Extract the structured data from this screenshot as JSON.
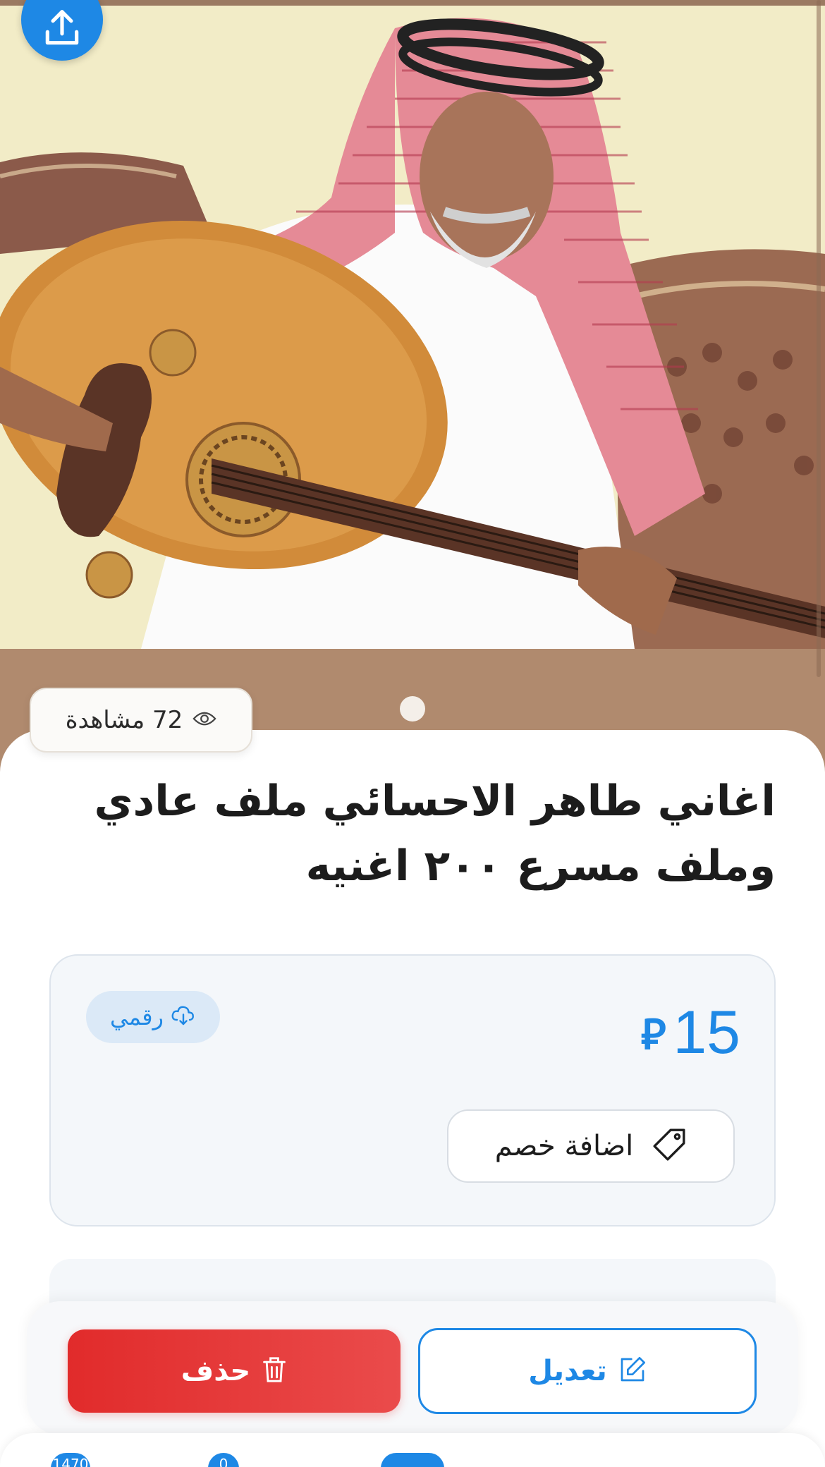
{
  "hero": {
    "image_alt": "Man in a red and white shemagh playing an oud",
    "share_icon": "share-upload-icon"
  },
  "stats": {
    "views_text": "72 مشاهدة",
    "views_icon": "eye-icon"
  },
  "gallery": {
    "active_index": 1,
    "total": 1
  },
  "product": {
    "title": "اغاني طاهر الاحسائي ملف عادي وملف مسرع ٢٠٠ اغنيه",
    "price": "15",
    "currency_symbol": "⃁",
    "type_label": "رقمي",
    "type_icon": "cloud-download-icon",
    "add_discount_label": "اضافة خصم",
    "add_discount_icon": "tag-icon"
  },
  "actions": {
    "edit_label": "تعديل",
    "edit_icon": "edit-icon",
    "delete_label": "حذف",
    "delete_icon": "trash-icon"
  },
  "tabbar": {
    "badge_1": "1470",
    "badge_2": "0"
  },
  "colors": {
    "accent": "#1e88e5",
    "danger": "#e12b2b",
    "backdrop": "#b08a6e"
  }
}
